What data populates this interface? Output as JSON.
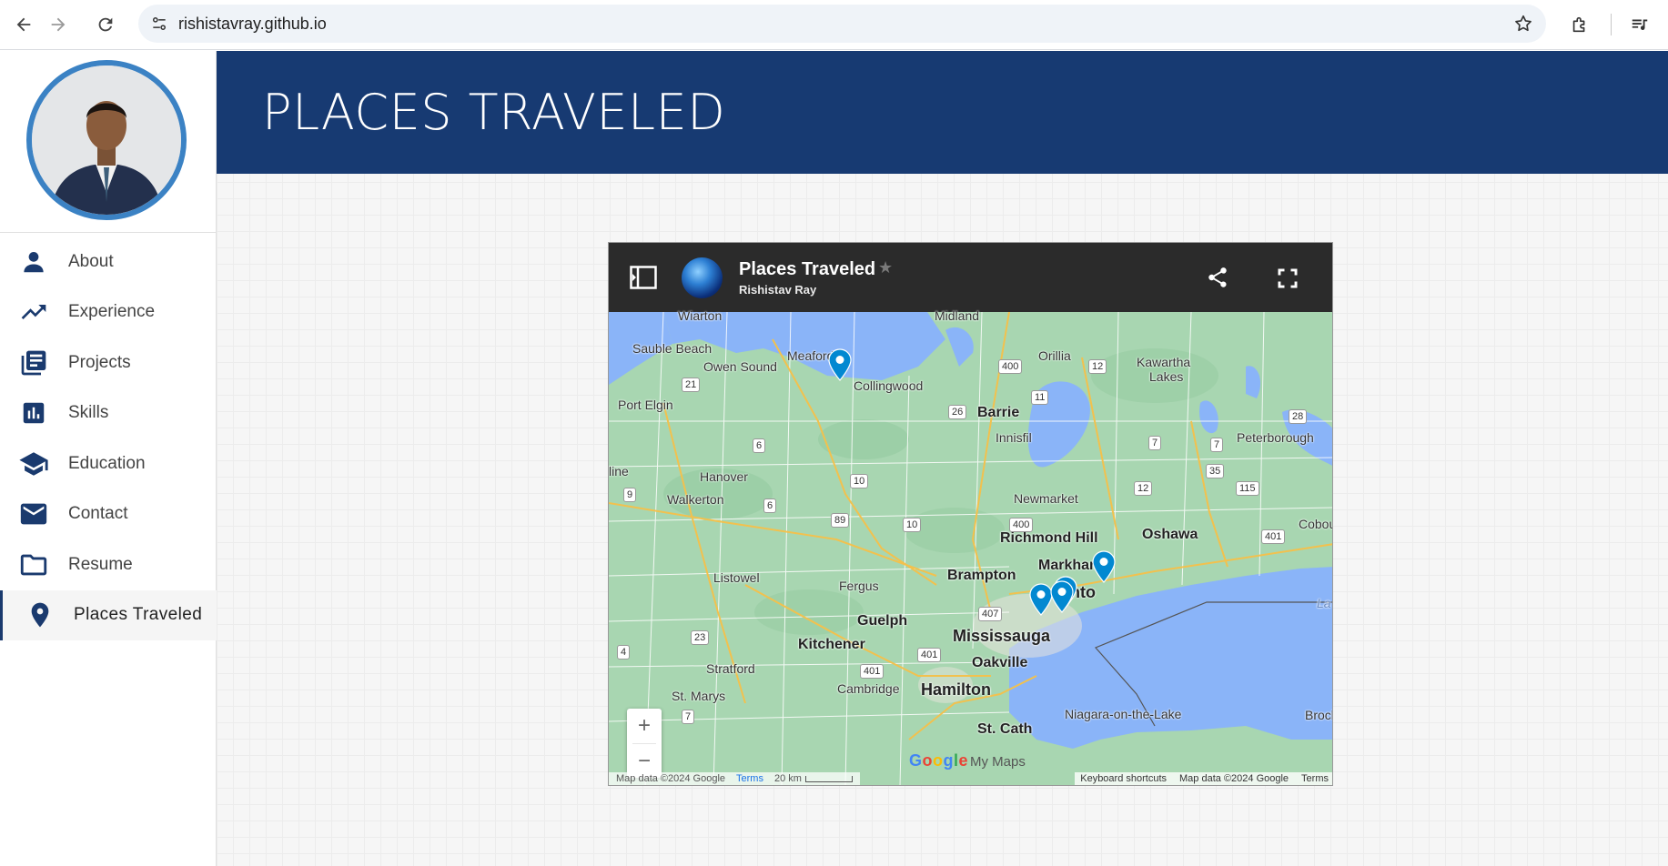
{
  "browser": {
    "url": "rishistavray.github.io",
    "back_icon": "arrow-left-icon",
    "forward_icon": "arrow-right-icon",
    "reload_icon": "reload-icon",
    "site_info_icon": "tune-icon",
    "bookmark_icon": "star-outline-icon",
    "extensions_icon": "puzzle-icon",
    "media_icon": "queue-music-icon"
  },
  "sidebar": {
    "avatar_icon": "profile-photo",
    "items": [
      {
        "label": "About",
        "icon": "person-icon"
      },
      {
        "label": "Experience",
        "icon": "trending-up-icon"
      },
      {
        "label": "Projects",
        "icon": "library-books-icon"
      },
      {
        "label": "Skills",
        "icon": "bar-chart-icon"
      },
      {
        "label": "Education",
        "icon": "school-icon"
      },
      {
        "label": "Contact",
        "icon": "mail-icon"
      },
      {
        "label": "Resume",
        "icon": "folder-icon"
      },
      {
        "label": "Places Traveled",
        "icon": "place-icon",
        "active": true
      }
    ]
  },
  "main": {
    "page_title": "PLACES TRAVELED"
  },
  "map": {
    "title": "Places Traveled",
    "author": "Rishistav Ray",
    "star": "★",
    "zoom_in": "+",
    "zoom_out": "−",
    "footer_left": {
      "data": "Map data ©2024 Google",
      "terms": "Terms",
      "scale": "20 km"
    },
    "footer_right": {
      "shortcuts": "Keyboard shortcuts",
      "data": "Map data ©2024 Google",
      "terms": "Terms"
    },
    "logo": "Google",
    "product": "My Maps",
    "places": {
      "wiarton": "Wiarton",
      "midland": "Midland",
      "sauble": "Sauble Beach",
      "meaford": "Meaford",
      "owen_sound": "Owen Sound",
      "collingwood": "Collingwood",
      "orillia": "Orillia",
      "kawartha": "Kawartha",
      "kawartha2": "Lakes",
      "port_elgin": "Port Elgin",
      "barrie": "Barrie",
      "innisfil": "Innisfil",
      "peterborough": "Peterborough",
      "line": "line",
      "hanover": "Hanover",
      "walkerton": "Walkerton",
      "newmarket": "Newmarket",
      "richmond_hill": "Richmond Hill",
      "oshawa": "Oshawa",
      "cobourg": "Cobour",
      "markham": "Markham",
      "brampton": "Brampton",
      "toronto": "nto",
      "listowel": "Listowel",
      "fergus": "Fergus",
      "guelph": "Guelph",
      "mississauga": "Mississauga",
      "kitchener": "Kitchener",
      "oakville": "Oakville",
      "stratford": "Stratford",
      "cambridge": "Cambridge",
      "hamilton": "Hamilton",
      "st_marys": "St. Marys",
      "niagara": "Niagara-on-the-Lake",
      "brock": "Brock",
      "st_cath": "St. Cath",
      "lake": "La"
    },
    "highways": [
      "400",
      "12",
      "21",
      "11",
      "26",
      "28",
      "7",
      "7",
      "35",
      "6",
      "10",
      "12",
      "115",
      "9",
      "6",
      "89",
      "10",
      "400",
      "401",
      "407",
      "23",
      "4",
      "401",
      "401",
      "7"
    ],
    "pin_icon": "map-pin-icon",
    "pin_color": "#0288d1",
    "land_color": "#a8d6b1",
    "water_color": "#8ab4f8",
    "banner_color": "#173a72"
  }
}
